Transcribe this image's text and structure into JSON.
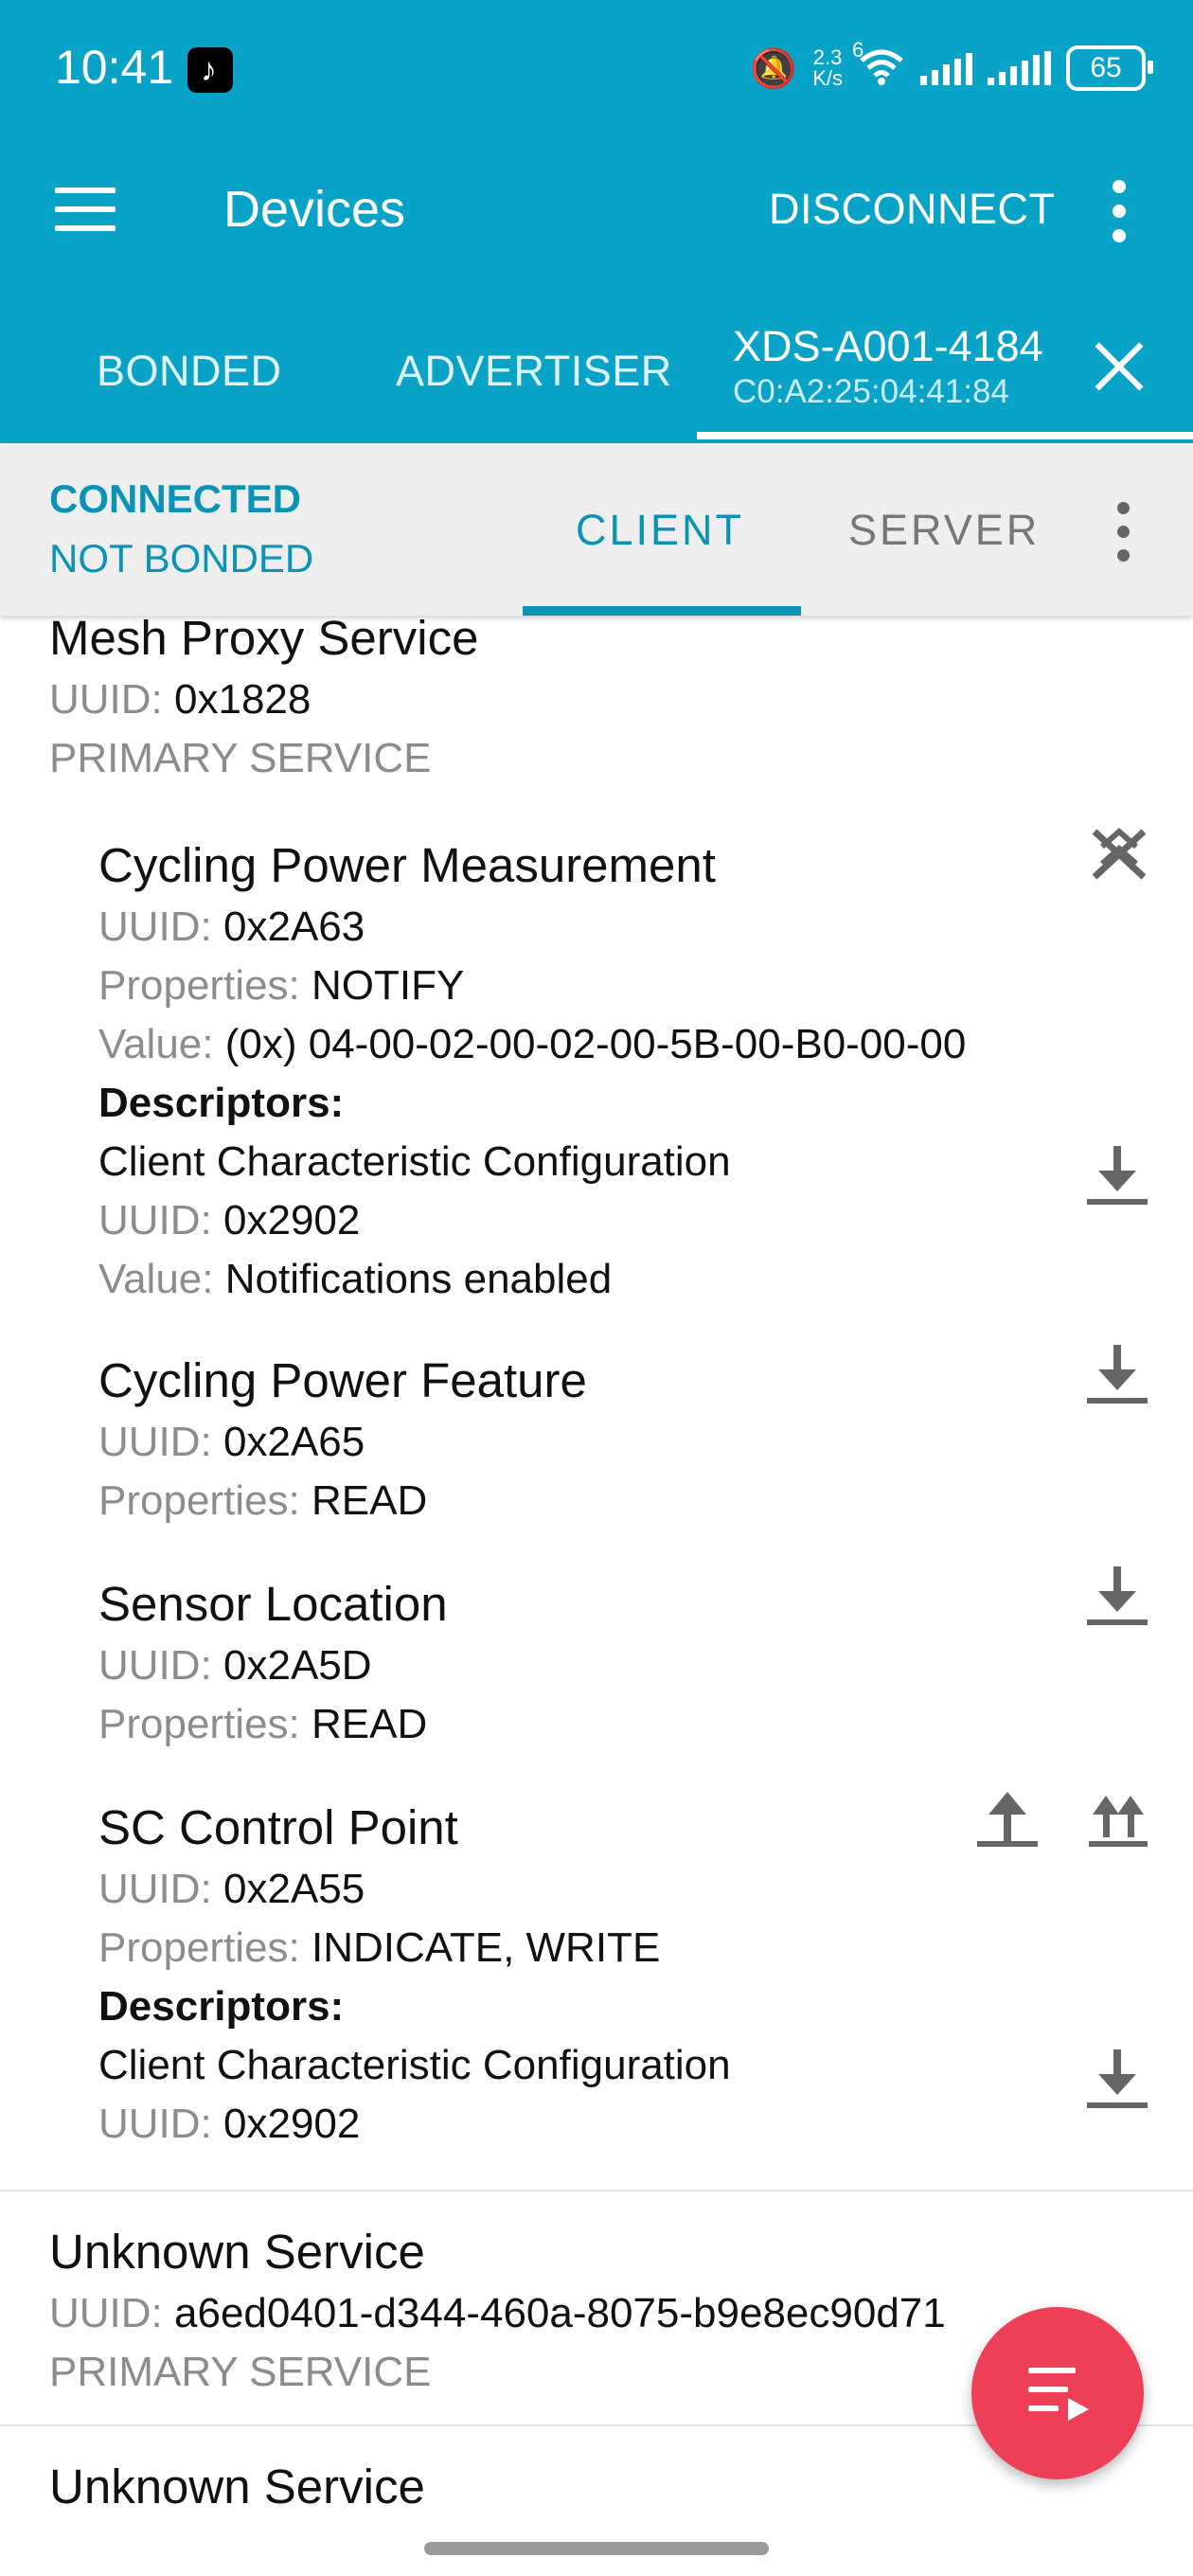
{
  "status_bar": {
    "time": "10:41",
    "network_speed_value": "2.3",
    "network_speed_unit": "K/s",
    "wifi_badge": "6",
    "battery": "65",
    "icons": [
      "tiktok-icon",
      "bell-off-icon",
      "wifi-icon",
      "signal-icon",
      "signal-icon",
      "battery-icon"
    ]
  },
  "app_bar": {
    "title": "Devices",
    "disconnect_label": "DISCONNECT",
    "menu_icon": "hamburger-menu-icon",
    "overflow_icon": "more-vert-icon"
  },
  "tabs": {
    "bonded": "BONDED",
    "advertiser": "ADVERTISER",
    "device_name": "XDS-A001-4184",
    "device_mac": "C0:A2:25:04:41:84",
    "active": "device"
  },
  "connection": {
    "state": "CONNECTED",
    "bond_state": "NOT BONDED",
    "client_tab": "CLIENT",
    "server_tab": "SERVER",
    "active_subtab": "CLIENT"
  },
  "labels": {
    "uuid": "UUID:",
    "properties": "Properties:",
    "value": "Value:",
    "descriptors": "Descriptors:",
    "primary_service": "PRIMARY SERVICE"
  },
  "services": [
    {
      "name": "Mesh Proxy Service",
      "uuid": "0x1828",
      "type": "PRIMARY SERVICE",
      "characteristics": [
        {
          "name": "Cycling Power Measurement",
          "uuid": "0x2A63",
          "properties": "NOTIFY",
          "value": "(0x) 04-00-02-00-02-00-5B-00-B0-00-00",
          "descriptors": [
            {
              "name": "Client Characteristic Configuration",
              "uuid": "0x2902",
              "value": "Notifications enabled"
            }
          ]
        },
        {
          "name": "Cycling Power Feature",
          "uuid": "0x2A65",
          "properties": "READ"
        },
        {
          "name": "Sensor Location",
          "uuid": "0x2A5D",
          "properties": "READ"
        },
        {
          "name": "SC Control Point",
          "uuid": "0x2A55",
          "properties": "INDICATE, WRITE",
          "descriptors": [
            {
              "name": "Client Characteristic Configuration",
              "uuid": "0x2902"
            }
          ]
        }
      ]
    },
    {
      "name": "Unknown Service",
      "uuid": "a6ed0401-d344-460a-8075-b9e8ec90d71",
      "type": "PRIMARY SERVICE"
    },
    {
      "name": "Unknown Service"
    }
  ],
  "colors": {
    "primary": "#0aa3c8",
    "accent": "#0a93b4",
    "fab": "#ef3f57"
  }
}
